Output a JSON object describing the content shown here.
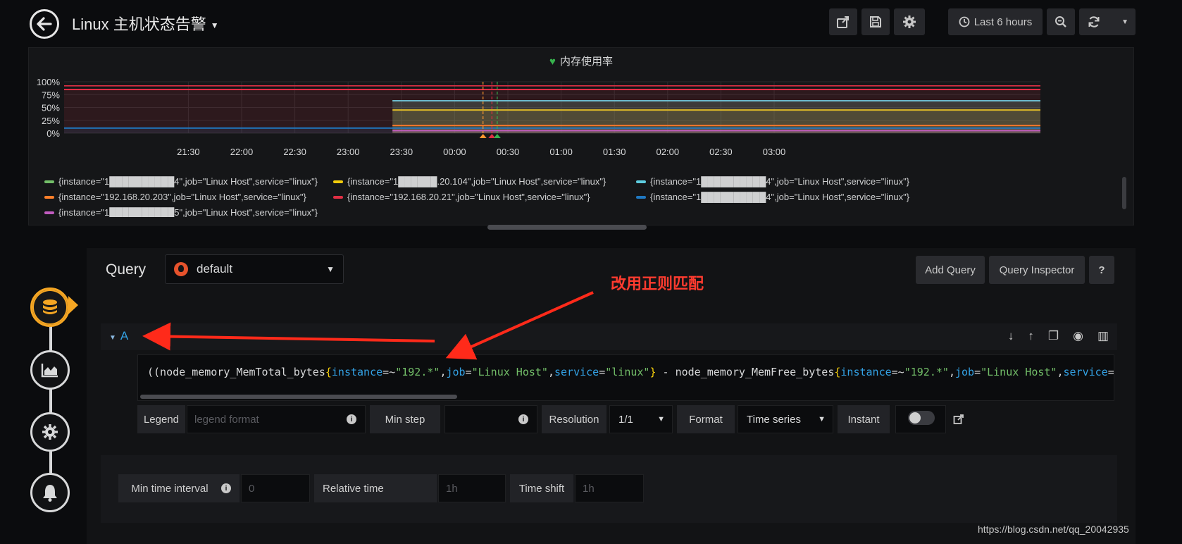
{
  "header": {
    "title": "Linux 主机状态告警",
    "time_range": "Last 6 hours"
  },
  "panel": {
    "title": "内存使用率"
  },
  "chart_data": {
    "type": "line",
    "x_ticks": [
      "21:30",
      "22:00",
      "22:30",
      "23:00",
      "23:30",
      "00:00",
      "00:30",
      "01:00",
      "01:30",
      "02:00",
      "02:30",
      "03:00"
    ],
    "y_ticks": [
      "100%",
      "75%",
      "50%",
      "25%",
      "0%"
    ],
    "ylim": [
      0,
      100
    ],
    "x_range_minutes": [
      -70,
      480
    ],
    "series": [
      {
        "name": "{instance=\"1██████████4\",job=\"Linux Host\",service=\"linux\"}",
        "color": "#73bf69",
        "segments": [
          [
            0,
            63
          ]
        ],
        "from": 115
      },
      {
        "name": "{instance=\"1██████.20.104\",job=\"Linux Host\",service=\"linux\"}",
        "color": "#f2cc0c",
        "segments": [
          [
            0,
            45
          ]
        ],
        "from": 115
      },
      {
        "name": "{instance=\"1██████████4\",job=\"Linux Host\",service=\"linux\"}",
        "color": "#5ecde0",
        "segments": [
          [
            0,
            63
          ]
        ],
        "from": 115
      },
      {
        "name": "{instance=\"192.168.20.203\",job=\"Linux Host\",service=\"linux\"}",
        "color": "#ff7f2a",
        "segments": [
          [
            0,
            15
          ]
        ],
        "from": 115
      },
      {
        "name": "{instance=\"192.168.20.21\",job=\"Linux Host\",service=\"linux\"}",
        "color": "#e02f44",
        "segments": [
          [
            0,
            85
          ]
        ],
        "from": -70
      },
      {
        "name": "{instance=\"1██████████4\",job=\"Linux Host\",service=\"linux\"}",
        "color": "#1f78c1",
        "segments": [
          [
            0,
            10
          ]
        ],
        "from": -70
      },
      {
        "name": "{instance=\"1██████████5\",job=\"Linux Host\",service=\"linux\"}",
        "color": "#c15cbf",
        "segments": [
          [
            0,
            5
          ]
        ],
        "from": 115
      }
    ],
    "thresholds": [
      {
        "value": 92,
        "color": "#e02f44"
      },
      {
        "value": 85,
        "color": "#e02f44"
      }
    ],
    "annotations": [
      {
        "minute": 166,
        "color": "#ff9830"
      },
      {
        "minute": 171,
        "color": "#e02f44"
      },
      {
        "minute": 174,
        "color": "#37b24d"
      }
    ]
  },
  "query": {
    "section_label": "Query",
    "datasource": "default",
    "add_query": "Add Query",
    "inspector": "Query Inspector",
    "help": "?",
    "ref_id": "A",
    "expr_parts": [
      {
        "t": "((node_memory_MemTotal_bytes",
        "c": "plain"
      },
      {
        "t": "{",
        "c": "brace"
      },
      {
        "t": "instance",
        "c": "key"
      },
      {
        "t": "=~",
        "c": "plain"
      },
      {
        "t": "\"192.*\"",
        "c": "str"
      },
      {
        "t": ",",
        "c": "plain"
      },
      {
        "t": "job",
        "c": "key"
      },
      {
        "t": "=",
        "c": "plain"
      },
      {
        "t": "\"Linux Host\"",
        "c": "str"
      },
      {
        "t": ",",
        "c": "plain"
      },
      {
        "t": "service",
        "c": "key"
      },
      {
        "t": "=",
        "c": "plain"
      },
      {
        "t": "\"linux\"",
        "c": "str"
      },
      {
        "t": "}",
        "c": "brace"
      },
      {
        "t": " - node_memory_MemFree_bytes",
        "c": "plain"
      },
      {
        "t": "{",
        "c": "brace"
      },
      {
        "t": "instance",
        "c": "key"
      },
      {
        "t": "=~",
        "c": "plain"
      },
      {
        "t": "\"192.*\"",
        "c": "str"
      },
      {
        "t": ",",
        "c": "plain"
      },
      {
        "t": "job",
        "c": "key"
      },
      {
        "t": "=",
        "c": "plain"
      },
      {
        "t": "\"Linux Host\"",
        "c": "str"
      },
      {
        "t": ",",
        "c": "plain"
      },
      {
        "t": "service",
        "c": "key"
      },
      {
        "t": "=",
        "c": "plain"
      },
      {
        "t": "\"linux\"",
        "c": "str"
      },
      {
        "t": "}",
        "c": "brace"
      }
    ],
    "legend_label": "Legend",
    "legend_placeholder": "legend format",
    "min_step_label": "Min step",
    "resolution_label": "Resolution",
    "resolution_value": "1/1",
    "format_label": "Format",
    "format_value": "Time series",
    "instant_label": "Instant"
  },
  "options": {
    "min_interval_label": "Min time interval",
    "min_interval_placeholder": "0",
    "relative_time_label": "Relative time",
    "relative_time_placeholder": "1h",
    "time_shift_label": "Time shift",
    "time_shift_placeholder": "1h"
  },
  "annotation_text": "改用正则匹配",
  "watermark": "https://blog.csdn.net/qq_20042935"
}
